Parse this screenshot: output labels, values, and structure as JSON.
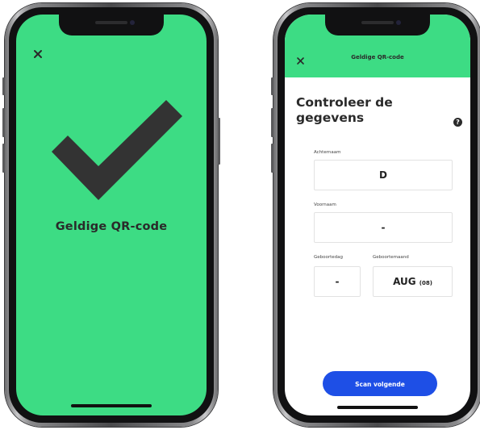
{
  "left_screen": {
    "title": "Geldige QR-code",
    "background": "#3ddc84",
    "close_icon": "close-icon",
    "check_icon": "checkmark-icon"
  },
  "right_screen": {
    "header_title": "Geldige QR-code",
    "header_background": "#3ddc84",
    "close_icon": "close-icon",
    "heading": "Controleer de gegevens",
    "help_icon": "help-icon",
    "help_glyph": "?",
    "fields": {
      "last_name": {
        "label": "Achternaam",
        "value": "D"
      },
      "first_name": {
        "label": "Voornaam",
        "value": "-"
      },
      "birth_day": {
        "label": "Geboortedag",
        "value": "-"
      },
      "birth_month": {
        "label": "Geboortemaand",
        "value": "AUG",
        "suffix": "(08)"
      }
    },
    "scan_button": {
      "label": "Scan volgende",
      "color": "#1e4fe6"
    }
  }
}
